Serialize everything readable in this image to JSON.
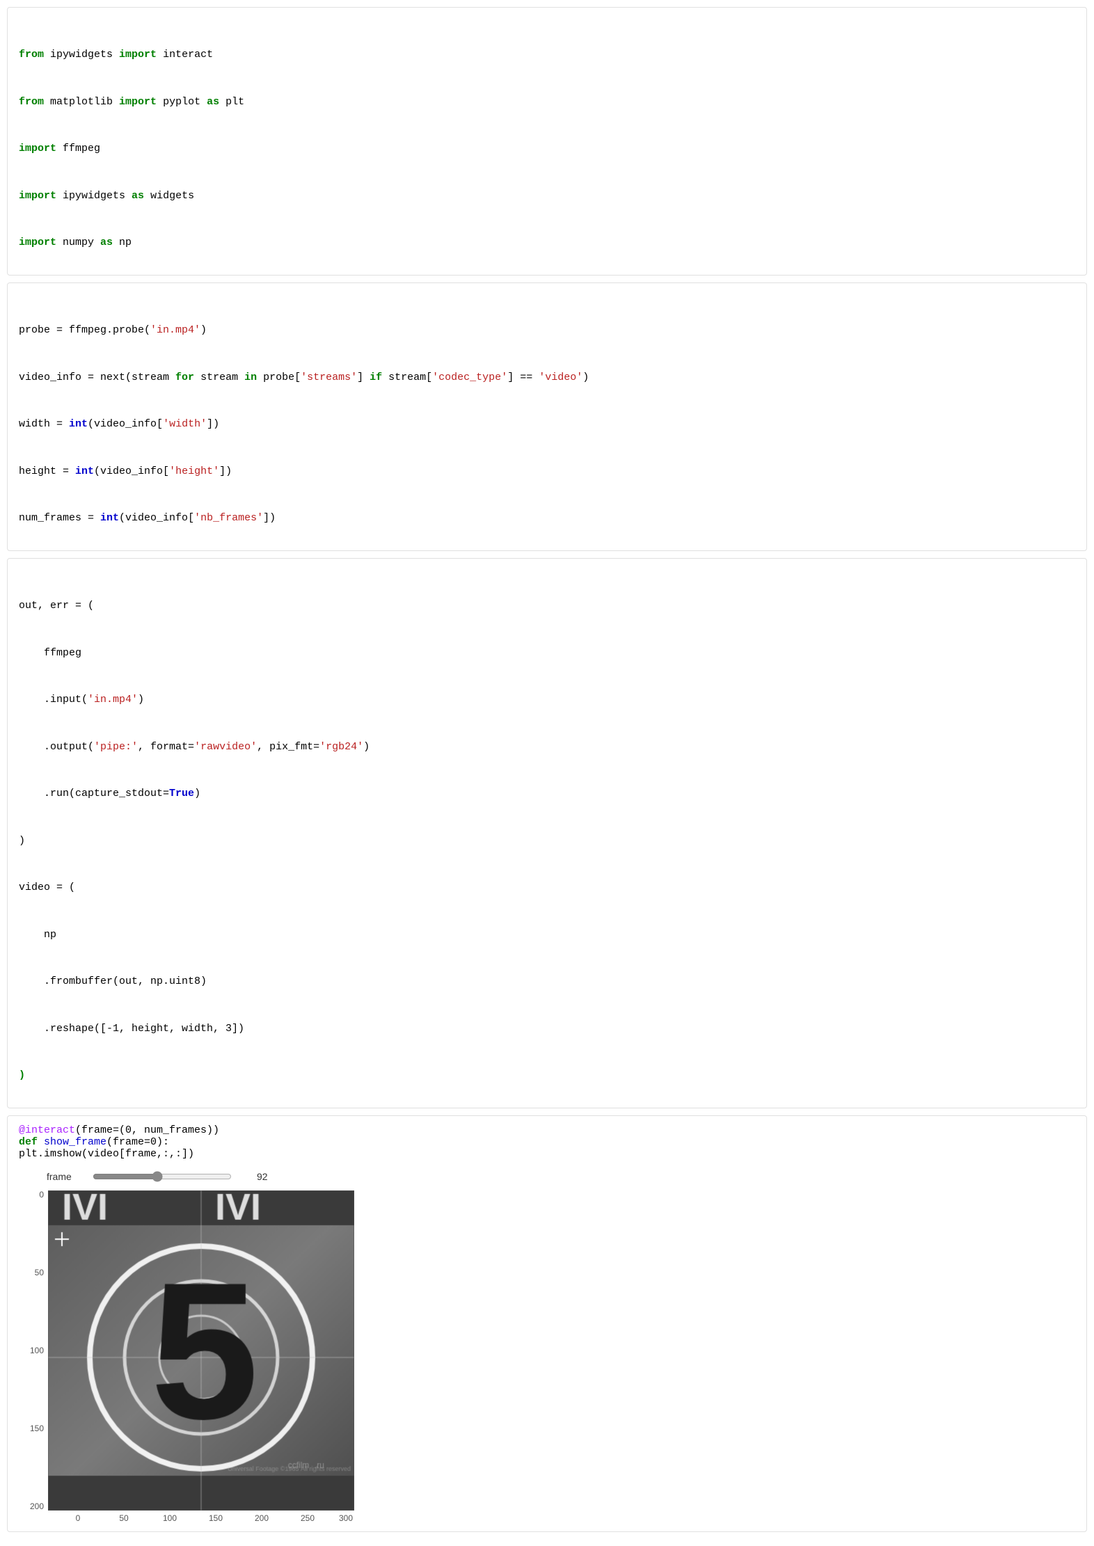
{
  "cell1": {
    "lines": [
      {
        "parts": [
          {
            "text": "from",
            "cls": "kw-green"
          },
          {
            "text": " ipywidgets ",
            "cls": "var-black"
          },
          {
            "text": "import",
            "cls": "kw-green"
          },
          {
            "text": " interact",
            "cls": "var-black"
          }
        ]
      },
      {
        "parts": [
          {
            "text": "from",
            "cls": "kw-green"
          },
          {
            "text": " matplotlib ",
            "cls": "var-black"
          },
          {
            "text": "import",
            "cls": "kw-green"
          },
          {
            "text": " pyplot ",
            "cls": "var-black"
          },
          {
            "text": "as",
            "cls": "kw-green"
          },
          {
            "text": " plt",
            "cls": "var-black"
          }
        ]
      },
      {
        "parts": [
          {
            "text": "import",
            "cls": "kw-green"
          },
          {
            "text": " ffmpeg",
            "cls": "var-black"
          }
        ]
      },
      {
        "parts": [
          {
            "text": "import",
            "cls": "kw-green"
          },
          {
            "text": " ipywidgets ",
            "cls": "var-black"
          },
          {
            "text": "as",
            "cls": "kw-green"
          },
          {
            "text": " widgets",
            "cls": "var-black"
          }
        ]
      },
      {
        "parts": [
          {
            "text": "import",
            "cls": "kw-green"
          },
          {
            "text": " numpy ",
            "cls": "var-black"
          },
          {
            "text": "as",
            "cls": "kw-green"
          },
          {
            "text": " np",
            "cls": "var-black"
          }
        ]
      }
    ]
  },
  "cell2": {
    "lines": [
      {
        "parts": [
          {
            "text": "probe",
            "cls": "var-black"
          },
          {
            "text": " = ",
            "cls": "op"
          },
          {
            "text": "ffmpeg.probe(",
            "cls": "var-black"
          },
          {
            "text": "'in.mp4'",
            "cls": "str-red"
          },
          {
            "text": ")",
            "cls": "var-black"
          }
        ]
      },
      {
        "parts": [
          {
            "text": "video_info",
            "cls": "var-black"
          },
          {
            "text": " = ",
            "cls": "op"
          },
          {
            "text": "next(stream ",
            "cls": "var-black"
          },
          {
            "text": "for",
            "cls": "kw-green"
          },
          {
            "text": " stream ",
            "cls": "var-black"
          },
          {
            "text": "in",
            "cls": "kw-green"
          },
          {
            "text": " probe[",
            "cls": "var-black"
          },
          {
            "text": "'streams'",
            "cls": "str-red"
          },
          {
            "text": "] ",
            "cls": "var-black"
          },
          {
            "text": "if",
            "cls": "kw-green"
          },
          {
            "text": " stream[",
            "cls": "var-black"
          },
          {
            "text": "'codec_type'",
            "cls": "str-red"
          },
          {
            "text": "] == ",
            "cls": "var-black"
          },
          {
            "text": "'video'",
            "cls": "str-red"
          },
          {
            "text": ")",
            "cls": "var-black"
          }
        ]
      },
      {
        "parts": [
          {
            "text": "width",
            "cls": "var-black"
          },
          {
            "text": " = ",
            "cls": "op"
          },
          {
            "text": "int",
            "cls": "kw-blue"
          },
          {
            "text": "(video_info[",
            "cls": "var-black"
          },
          {
            "text": "'width'",
            "cls": "str-red"
          },
          {
            "text": "])",
            "cls": "var-black"
          }
        ]
      },
      {
        "parts": [
          {
            "text": "height",
            "cls": "var-black"
          },
          {
            "text": " = ",
            "cls": "op"
          },
          {
            "text": "int",
            "cls": "kw-blue"
          },
          {
            "text": "(video_info[",
            "cls": "var-black"
          },
          {
            "text": "'height'",
            "cls": "str-red"
          },
          {
            "text": "])",
            "cls": "var-black"
          }
        ]
      },
      {
        "parts": [
          {
            "text": "num_frames",
            "cls": "var-black"
          },
          {
            "text": " = ",
            "cls": "op"
          },
          {
            "text": "int",
            "cls": "kw-blue"
          },
          {
            "text": "(video_info[",
            "cls": "var-black"
          },
          {
            "text": "'nb_frames'",
            "cls": "str-red"
          },
          {
            "text": "])",
            "cls": "var-black"
          }
        ]
      }
    ]
  },
  "cell3": {
    "lines": [
      {
        "raw": "out, err = ("
      },
      {
        "raw": "    ffmpeg"
      },
      {
        "raw": "    .input(",
        "parts": [
          {
            "text": "    .input(",
            "cls": "var-black"
          },
          {
            "text": "'in.mp4'",
            "cls": "str-red"
          },
          {
            "text": ")",
            "cls": "var-black"
          }
        ]
      },
      {
        "raw": "    .output(",
        "parts": [
          {
            "text": "    .output(",
            "cls": "var-black"
          },
          {
            "text": "'pipe:'",
            "cls": "str-red"
          },
          {
            "text": ", format=",
            "cls": "var-black"
          },
          {
            "text": "'rawvideo'",
            "cls": "str-red"
          },
          {
            "text": ", pix_fmt=",
            "cls": "var-black"
          },
          {
            "text": "'rgb24'",
            "cls": "str-red"
          },
          {
            "text": ")",
            "cls": "var-black"
          }
        ]
      },
      {
        "parts": [
          {
            "text": "    .run(capture_stdout=",
            "cls": "var-black"
          },
          {
            "text": "True",
            "cls": "kw-blue"
          },
          {
            "text": ")",
            "cls": "var-black"
          }
        ]
      },
      {
        "raw": ")"
      },
      {
        "parts": [
          {
            "text": "video",
            "cls": "var-black"
          },
          {
            "text": " = (",
            "cls": "op"
          }
        ]
      },
      {
        "raw": "    np"
      },
      {
        "parts": [
          {
            "text": "    .frombuffer(out, np.uint8)",
            "cls": "var-black"
          }
        ]
      },
      {
        "parts": [
          {
            "text": "    .reshape([-1, height, width, 3])",
            "cls": "var-black"
          }
        ]
      },
      {
        "parts": [
          {
            "text": ")",
            "cls": "kw-green"
          }
        ]
      }
    ]
  },
  "cell4": {
    "lines": [
      {
        "parts": [
          {
            "text": "@interact",
            "cls": "decorator"
          },
          {
            "text": "(frame=(0, num_frames))",
            "cls": "var-black"
          }
        ]
      },
      {
        "parts": [
          {
            "text": "def",
            "cls": "kw-def"
          },
          {
            "text": " show_frame",
            "cls": "func-blue"
          },
          {
            "text": "(frame=0):",
            "cls": "var-black"
          }
        ]
      },
      {
        "parts": [
          {
            "text": "    plt.imshow(video[frame,:,:])",
            "cls": "var-black"
          }
        ]
      }
    ]
  },
  "slider": {
    "label": "frame",
    "min": 0,
    "max": 200,
    "value": 92,
    "display_value": "92"
  },
  "plot": {
    "y_ticks": [
      "0",
      "50",
      "100",
      "150",
      "200"
    ],
    "x_ticks": [
      "0",
      "50",
      "100",
      "150",
      "200",
      "250",
      "300"
    ]
  }
}
